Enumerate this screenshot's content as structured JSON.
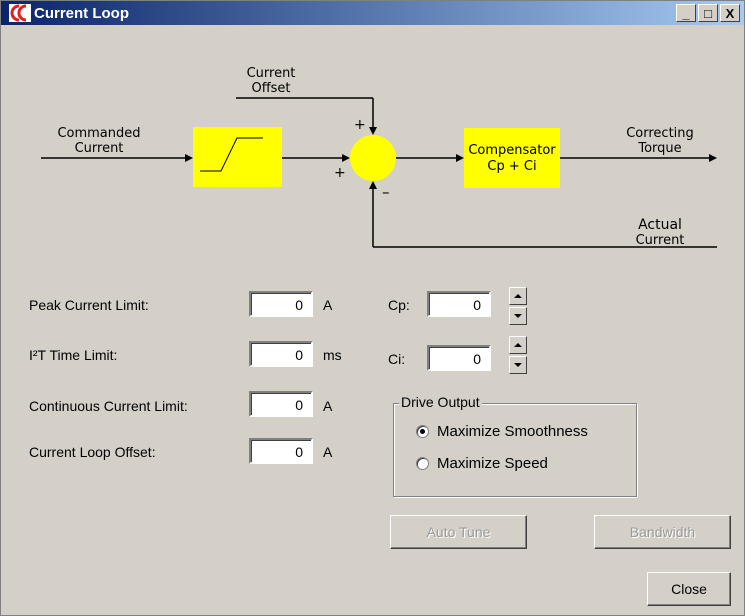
{
  "window": {
    "title": "Current Loop",
    "min_glyph": "_",
    "max_glyph": "□",
    "close_glyph": "X"
  },
  "diagram": {
    "current_offset": [
      "Current",
      "Offset"
    ],
    "commanded_current": [
      "Commanded",
      "Current"
    ],
    "correcting_torque": [
      "Correcting",
      "Torque"
    ],
    "actual_current": [
      "Actual",
      "Current"
    ],
    "compensator": [
      "Compensator",
      "Cp + Ci"
    ],
    "plus_top": "+",
    "plus_left": "+",
    "minus": "–",
    "block_color": "#ffff00"
  },
  "fields": {
    "peak_label": "Peak Current Limit:",
    "peak_value": "0",
    "peak_unit": "A",
    "i2t_label": "I²T Time Limit:",
    "i2t_value": "0",
    "i2t_unit": "ms",
    "continuous_label": "Continuous Current Limit:",
    "continuous_value": "0",
    "continuous_unit": "A",
    "offset_label": "Current Loop Offset:",
    "offset_value": "0",
    "offset_unit": "A",
    "cp_label": "Cp:",
    "cp_value": "0",
    "ci_label": "Ci:",
    "ci_value": "0"
  },
  "drive_output": {
    "legend": "Drive Output",
    "option1": "Maximize Smoothness",
    "option2": "Maximize Speed",
    "selected": "Maximize Smoothness"
  },
  "buttons": {
    "auto_tune": "Auto Tune",
    "bandwidth": "Bandwidth",
    "close": "Close"
  }
}
